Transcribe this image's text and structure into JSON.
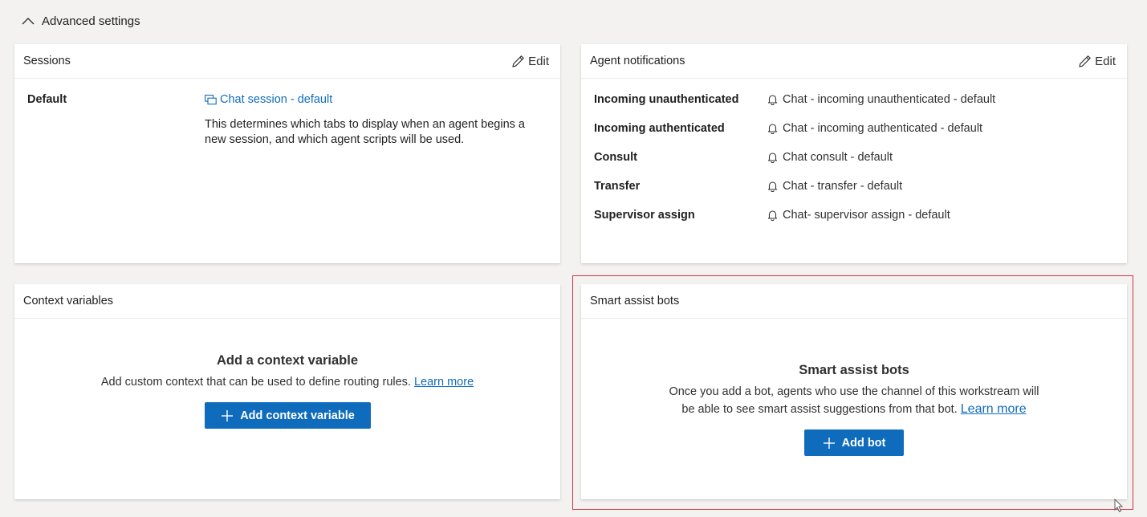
{
  "advanced": {
    "title": "Advanced settings",
    "icon": "chevron-up-icon"
  },
  "sessions": {
    "title": "Sessions",
    "edit_label": "Edit",
    "default_label": "Default",
    "link_text": "Chat session - default",
    "description": "This determines which tabs to display when an agent begins a new session, and which agent scripts will be used."
  },
  "notifications": {
    "title": "Agent notifications",
    "edit_label": "Edit",
    "items": [
      {
        "label": "Incoming unauthenticated",
        "value": "Chat - incoming unauthenticated - default"
      },
      {
        "label": "Incoming authenticated",
        "value": "Chat - incoming authenticated - default"
      },
      {
        "label": "Consult",
        "value": "Chat consult - default"
      },
      {
        "label": "Transfer",
        "value": "Chat - transfer - default"
      },
      {
        "label": "Supervisor assign",
        "value": "Chat- supervisor assign - default"
      }
    ]
  },
  "context": {
    "title": "Context variables",
    "empty_title": "Add a context variable",
    "empty_desc": "Add custom context that can be used to define routing rules.",
    "learn_more": "Learn more",
    "button_label": "Add context variable"
  },
  "smart": {
    "title": "Smart assist bots",
    "empty_title": "Smart assist bots",
    "empty_desc_line1": "Once you add a bot, agents who use the channel of this workstream will",
    "empty_desc_line2": "be able to see smart assist suggestions from that bot.",
    "learn_more": "Learn more",
    "button_label": "Add bot"
  },
  "colors": {
    "accent": "#0f6cbd",
    "highlight": "#d13438",
    "background": "#f3f2f1"
  }
}
